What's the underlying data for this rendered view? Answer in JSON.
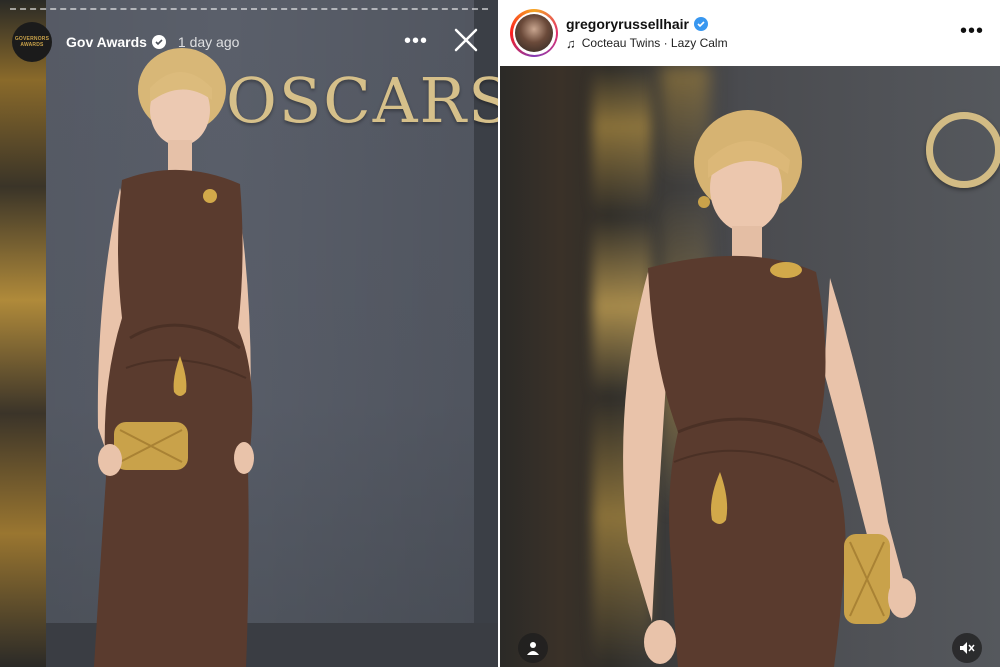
{
  "story": {
    "account_name": "Gov Awards",
    "avatar_text_line1": "GOVERNORS",
    "avatar_text_line2": "AWARDS",
    "timestamp": "1 day ago",
    "backdrop_sign": "OSCARS",
    "icons": {
      "more": "more-horizontal-icon",
      "close": "close-icon",
      "verified": "verified-badge-icon"
    }
  },
  "post": {
    "username": "gregoryrussellhair",
    "music": "Cocteau Twins · Lazy Calm",
    "icons": {
      "music": "music-note-icon",
      "more": "more-horizontal-icon",
      "tag": "user-tag-icon",
      "mute": "speaker-muted-icon",
      "verified": "verified-badge-icon"
    }
  },
  "colors": {
    "story_wall": "#585d68",
    "dress": "#5a3b2e",
    "gold": "#c9a24a",
    "verified_blue": "#3897f0"
  }
}
